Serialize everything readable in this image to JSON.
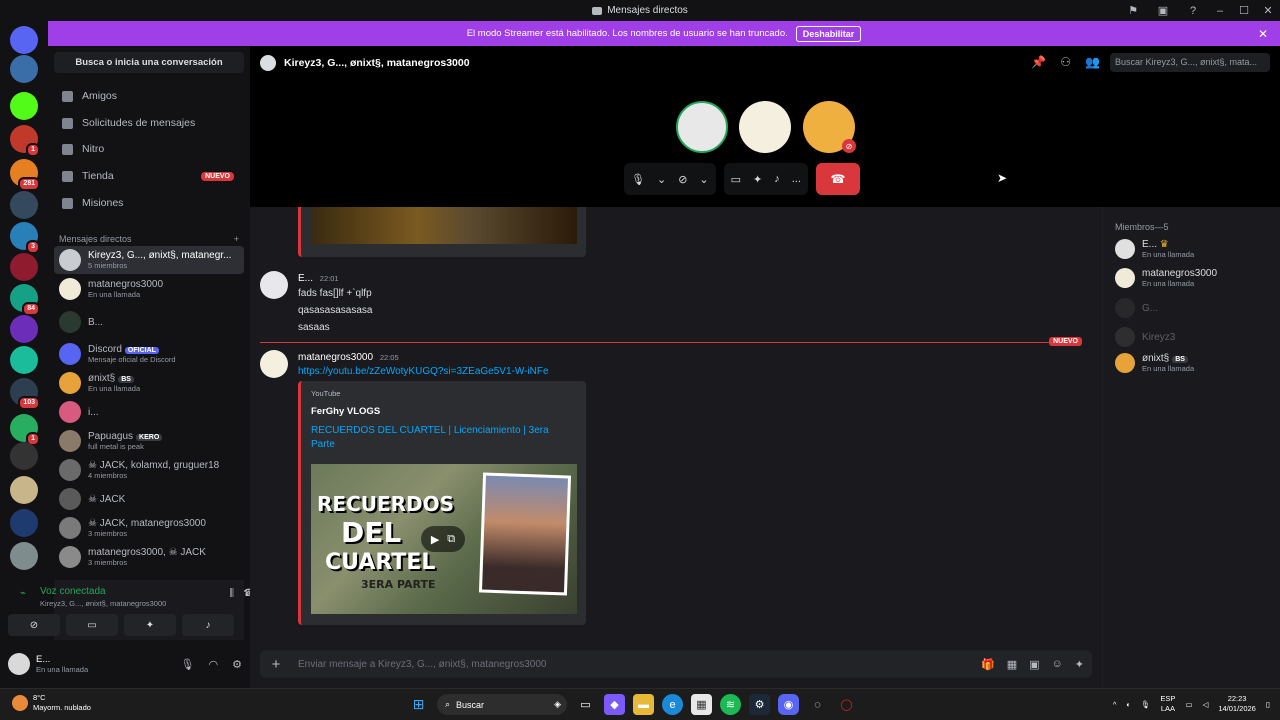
{
  "window": {
    "title": "Mensajes directos",
    "controls": [
      "minimize",
      "maximize",
      "close"
    ],
    "top_icons": [
      "inbox-icon",
      "window-icon",
      "help-icon"
    ]
  },
  "rail": {
    "servers": [
      {
        "name": "discord-home",
        "color": "#5865f2",
        "badge": null
      },
      {
        "name": "server-1",
        "color": "#3a6ea8",
        "badge": null
      },
      {
        "name": "server-kick",
        "color": "#53fc18",
        "badge": null
      },
      {
        "name": "server-2",
        "color": "#c0392b",
        "badge": "1"
      },
      {
        "name": "server-3",
        "color": "#e67e22",
        "badge": "281"
      },
      {
        "name": "server-4",
        "color": "#34495e",
        "badge": null
      },
      {
        "name": "server-5",
        "color": "#2980b9",
        "badge": "3"
      },
      {
        "name": "server-6",
        "color": "#8e1b2e",
        "badge": null
      },
      {
        "name": "server-7",
        "color": "#16a085",
        "badge": "84"
      },
      {
        "name": "server-8",
        "color": "#6c2eb9",
        "badge": null
      },
      {
        "name": "server-9",
        "color": "#1abc9c",
        "badge": null
      },
      {
        "name": "server-10",
        "color": "#2c3e50",
        "badge": "103"
      },
      {
        "name": "server-11",
        "color": "#27ae60",
        "badge": "1"
      },
      {
        "name": "server-12",
        "color": "#333333",
        "badge": null
      },
      {
        "name": "server-13",
        "color": "#c8b58a",
        "badge": null
      },
      {
        "name": "server-14",
        "color": "#1f3a6e",
        "badge": null
      },
      {
        "name": "server-15",
        "color": "#7f8c8d",
        "badge": null
      }
    ]
  },
  "banner": {
    "text": "El modo Streamer está habilitado. Los nombres de usuario se han truncado.",
    "button": "Deshabilitar"
  },
  "sidebar": {
    "search_label": "Busca o inicia una conversación",
    "nav": [
      {
        "label": "Amigos",
        "icon": "friends-icon"
      },
      {
        "label": "Solicitudes de mensajes",
        "icon": "envelope-icon"
      },
      {
        "label": "Nitro",
        "icon": "nitro-icon"
      },
      {
        "label": "Tienda",
        "icon": "shop-icon",
        "badge": "NUEVO"
      },
      {
        "label": "Misiones",
        "icon": "quests-icon"
      }
    ],
    "dm_header": "Mensajes directos",
    "dm_add": "+",
    "dms": [
      {
        "name": "Kireyz3, G..., ønixt§, matanegr...",
        "sub": "5 miembros",
        "active": true,
        "color": "#c9cdd2"
      },
      {
        "name": "matanegros3000",
        "sub": "En una llamada",
        "color": "#f0ead8"
      },
      {
        "name": "B...",
        "sub": "",
        "color": "#2a3a30"
      },
      {
        "name": "Discord",
        "tag": "OFICIAL",
        "tag_color": "#5865f2",
        "sub": "Mensaje oficial de Discord",
        "color": "#5865f2"
      },
      {
        "name": "ønixt§",
        "tag": "BS",
        "tag_color": "#3a3b40",
        "sub": "En una llamada",
        "color": "#e8a23a"
      },
      {
        "name": "i...",
        "sub": "",
        "color": "#d85a7f"
      },
      {
        "name": "Papuagus",
        "tag": "KERO",
        "tag_color": "#3a3b40",
        "sub": "full metal is peak",
        "color": "#8a7a6a"
      },
      {
        "name": "☠ JACK, kolamxd, gruguer18",
        "sub": "4 miembros",
        "color": "#6a6a6a"
      },
      {
        "name": "☠ JACK",
        "sub": "",
        "color": "#5a5a5a"
      },
      {
        "name": "☠ JACK, matanegros3000",
        "sub": "3 miembros",
        "color": "#7a7a7a"
      },
      {
        "name": "matanegros3000, ☠ JACK",
        "sub": "3 miembros",
        "color": "#8a8a8a"
      }
    ],
    "voice": {
      "status": "Voz conectada",
      "channel": "Kireyz3, G..., ønixt§, matanegros3000",
      "buttons": [
        "camera-off-icon",
        "screen-share-icon",
        "activities-icon",
        "soundboard-icon"
      ]
    },
    "user": {
      "name": "E...",
      "status": "En una llamada"
    }
  },
  "header": {
    "title": "Kireyz3, G..., ønixt§, matanegros3000",
    "search_placeholder": "Buscar Kireyz3, G..., ønixt§, mata..."
  },
  "call": {
    "controls": {
      "mic": "mic-icon",
      "camera": "camera-off-icon",
      "share": "screen-share-icon",
      "activities": "activities-icon",
      "soundboard": "soundboard-icon",
      "more": "...",
      "hangup": "hangup-icon"
    }
  },
  "messages": [
    {
      "author": "E...",
      "time": "22:01",
      "lines": [
        "fads fas[]lf +`qlfp",
        "qasasasasasasa",
        "sasaas"
      ]
    },
    {
      "author": "matanegros3000",
      "time": "22:05",
      "link": "https://youtu.be/zZeWotyKUGQ?si=3ZEaGe5V1-W-iNFe",
      "embed": {
        "provider": "YouTube",
        "author": "FerGhy VLOGS",
        "title": "RECUERDOS DEL CUARTEL | Licenciamiento | 3era Parte",
        "thumb_lines": [
          "RECUERDOS",
          "DEL",
          "CUARTEL",
          "3ERA PARTE"
        ]
      }
    }
  ],
  "new_divider": "NUEVO",
  "members": {
    "header": "Miembros—5",
    "list": [
      {
        "name": "E...",
        "status": "En una llamada",
        "crown": true,
        "color": "#e0e0e0"
      },
      {
        "name": "matanegros3000",
        "status": "En una llamada",
        "color": "#f0ead8"
      },
      {
        "name": "G...",
        "status": "",
        "dim": true,
        "color": "#444"
      },
      {
        "name": "Kireyz3",
        "status": "",
        "dim": true,
        "color": "#555"
      },
      {
        "name": "ønixt§",
        "tag": "BS",
        "status": "En una llamada",
        "color": "#e8a23a"
      }
    ]
  },
  "composer": {
    "placeholder": "Enviar mensaje a Kireyz3, G..., ønixt§, matanegros3000"
  },
  "taskbar": {
    "weather_temp": "8°C",
    "weather_desc": "Mayorm. nublado",
    "search": "Buscar",
    "lang1": "ESP",
    "lang2": "LAA",
    "time": "22:23",
    "date": "14/01/2026"
  }
}
